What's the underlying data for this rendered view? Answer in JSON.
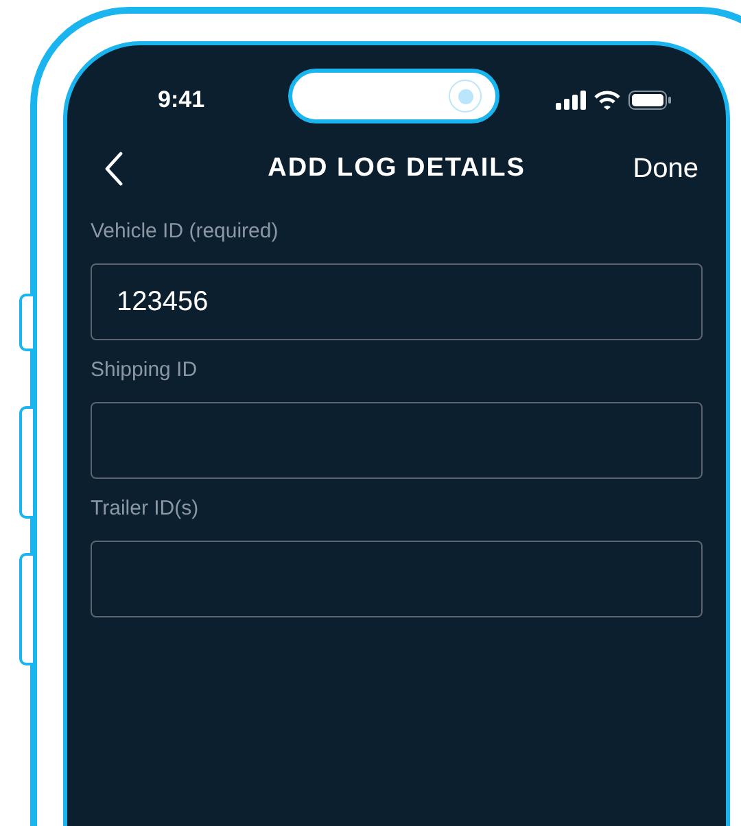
{
  "status_bar": {
    "time": "9:41"
  },
  "nav_bar": {
    "title": "ADD LOG DETAILS",
    "action": "Done"
  },
  "fields": [
    {
      "label": "Vehicle ID (required)",
      "value": "123456"
    },
    {
      "label": "Shipping ID"
    },
    {
      "label": "Trailer ID(s)"
    }
  ]
}
